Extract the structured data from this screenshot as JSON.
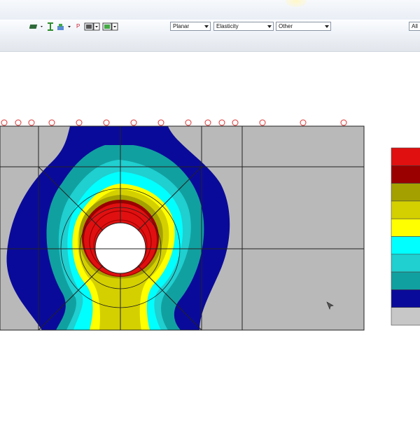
{
  "toolbar": {
    "dropdowns": [
      {
        "name": "analysis-type-dropdown",
        "value": "Planar"
      },
      {
        "name": "result-type-dropdown",
        "value": "Elasticity"
      },
      {
        "name": "other-dropdown",
        "value": "Other"
      },
      {
        "name": "all-dropdown",
        "value": "All"
      }
    ],
    "icons": [
      "plate-icon",
      "beam-icon",
      "load-icon",
      "p-icon",
      "mesh-icon",
      "view-icon"
    ],
    "p_label": "P"
  },
  "model": {
    "result_colors": [
      "#e01010",
      "#9a0000",
      "#a4a000",
      "#d4d000",
      "#ffff00",
      "#00ffff",
      "#20cfd0",
      "#11a0a0",
      "#0a0a9a",
      "#bdbdbd"
    ],
    "background_gray": "#b9b9b9",
    "supports_count": 15
  },
  "legend": {
    "colors": [
      "#e01010",
      "#9a0000",
      "#a4a000",
      "#d4d000",
      "#ffff00",
      "#00ffff",
      "#20cfd0",
      "#11a0a0",
      "#0a0a9a",
      "#c7c7c7"
    ]
  }
}
